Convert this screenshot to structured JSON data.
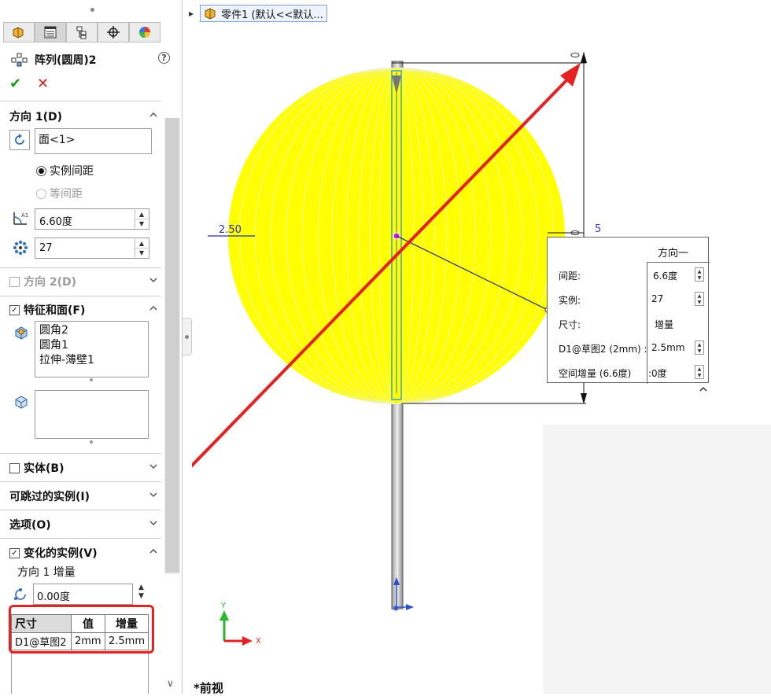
{
  "property_manager": {
    "tabs": [
      {
        "name": "feature-manager-tab-icon"
      },
      {
        "name": "property-manager-tab-icon"
      },
      {
        "name": "configuration-manager-tab-icon"
      },
      {
        "name": "dimxpert-tab-icon"
      },
      {
        "name": "display-manager-tab-icon"
      }
    ],
    "title": "阵列(圆周)2",
    "help": "?",
    "ok": "✔",
    "cancel": "✕",
    "direction1": {
      "label": "方向 1(D)",
      "axis_field": "面<1>",
      "radio_instance_spacing": "实例间距",
      "radio_equal_spacing": "等间距",
      "angle": "6.60度",
      "count": "27"
    },
    "direction2": {
      "label": "方向 2(D)"
    },
    "features_faces": {
      "label": "特征和面(F)",
      "features": [
        "圆角2",
        "圆角1",
        "拉伸-薄壁1"
      ]
    },
    "bodies": {
      "label": "实体(B)"
    },
    "skip_instances": {
      "label": "可跳过的实例(I)"
    },
    "options": {
      "label": "选项(O)"
    },
    "vary_instances": {
      "label": "变化的实例(V)",
      "dir1_increment_label": "方向 1 增量",
      "dir1_increment_value": "0.00度",
      "table": {
        "headers": [
          "尺寸",
          "值",
          "增量"
        ],
        "rows": [
          [
            "D1@草图2",
            "2mm",
            "2.5mm"
          ]
        ]
      }
    }
  },
  "graphics": {
    "breadcrumb": "零件1 (默认<<默认...",
    "dimension_left": "2.50",
    "dimension_right": "5",
    "axis_y": "Y",
    "axis_x": "X",
    "view_name": "*前视"
  },
  "modify_box": {
    "header": "方向一",
    "rows": [
      {
        "label": "间距:",
        "value": "6.6度"
      },
      {
        "label": "实例:",
        "value": "27"
      },
      {
        "label": "尺寸:",
        "value": "增量"
      },
      {
        "label": "D1@草图2 (2mm) :",
        "value": "2.5mm"
      },
      {
        "label": "空间增量 (6.6度)",
        "value": ":0度"
      }
    ]
  },
  "colors": {
    "sphere": "#ffff00",
    "annotation_arrow": "#e52222",
    "highlight_box": "#e52222"
  }
}
